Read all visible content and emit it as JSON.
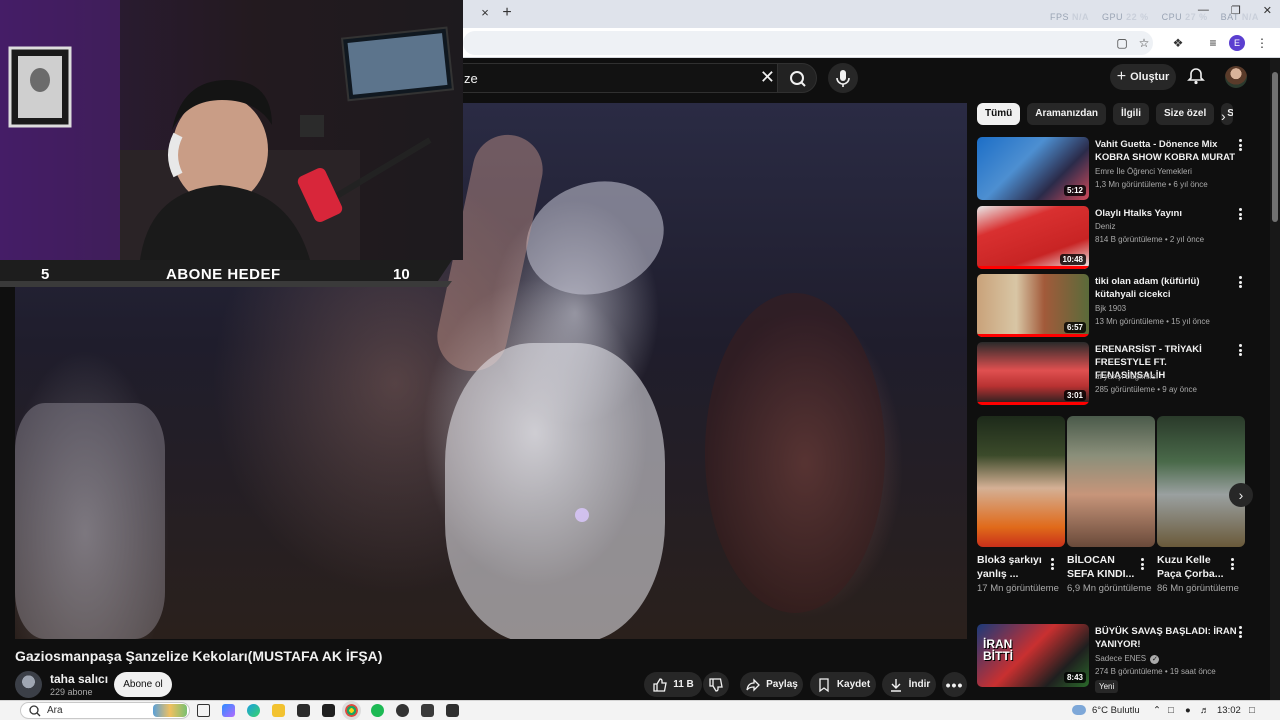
{
  "browser": {
    "tab_close": "×",
    "tab_new": "+",
    "stats": {
      "fps_label": "FPS",
      "fps_value": "N/A",
      "gpu_label": "GPU",
      "gpu_value": "22 %",
      "cpu_label": "CPU",
      "cpu_value": "27 %",
      "bat_label": "BAT",
      "bat_value": "N/A"
    },
    "profile_initial": "E"
  },
  "youtube": {
    "search_value": "ze",
    "create_label": "Oluştur"
  },
  "webcam_overlay": {
    "goal_start": "5",
    "goal_title": "ABONE HEDEF",
    "goal_end": "10"
  },
  "video": {
    "title": "Gaziosmanpaşa Şanzelize Kekoları(MUSTAFA AK İFŞA)",
    "channel_name": "taha salıcı",
    "channel_subs": "229 abone",
    "subscribe_label": "Abone ol",
    "likes": "11 B",
    "share_label": "Paylaş",
    "save_label": "Kaydet",
    "download_label": "İndir"
  },
  "sidebar": {
    "chips": [
      "Tümü",
      "Aramanızdan",
      "İlgili",
      "Size özel",
      "S"
    ],
    "recommendations": [
      {
        "title": "Vahit Guetta - Dönence Mix KOBRA SHOW KOBRA MURAT",
        "channel": "Emre İle Öğrenci Yemekleri",
        "meta": "1,3 Mn görüntüleme • 6 yıl önce",
        "duration": "5:12",
        "progress": 0.0
      },
      {
        "title": "Olaylı Htalks Yayını",
        "channel": "Deniz",
        "meta": "814 B görüntüleme • 2 yıl önce",
        "duration": "10:48",
        "progress": 1.0
      },
      {
        "title": "tiki olan adam (küfürlü) kütahyali cicekci",
        "channel": "Bjk 1903",
        "meta": "13 Mn görüntüleme • 15 yıl önce",
        "duration": "6:57",
        "progress": 1.0
      },
      {
        "title": "ERENARSİST - TRİYAKİ FREESTYLE FT. FENASİNSALİH",
        "channel": "at yarışı bağımlısı",
        "meta": "285 görüntüleme • 9 ay önce",
        "duration": "3:01",
        "progress": 1.0
      }
    ],
    "shorts": [
      {
        "title": "Blok3 şarkıyı yanlış ...",
        "views": "17 Mn görüntüleme"
      },
      {
        "title": "BİLOCAN SEFA KINDI...",
        "views": "6,9 Mn görüntüleme"
      },
      {
        "title": "Kuzu Kelle Paça Çorba...",
        "views": "86 Mn görüntüleme"
      }
    ],
    "last_rec": {
      "title": "BÜYÜK SAVAŞ BAŞLADI: İRAN YANIYOR!",
      "channel": "Sadece ENES",
      "meta": "274 B görüntüleme • 19 saat önce",
      "duration": "8:43",
      "badge": "Yeni",
      "thumb_text": "İRAN BİTTİ"
    }
  },
  "taskbar": {
    "search_placeholder": "Ara",
    "weather": "6°C Bulutlu",
    "time": "13:02"
  },
  "colors": {
    "accent_red": "#ff0000",
    "bg": "#0f0f0f",
    "chip_bg": "#272727"
  }
}
